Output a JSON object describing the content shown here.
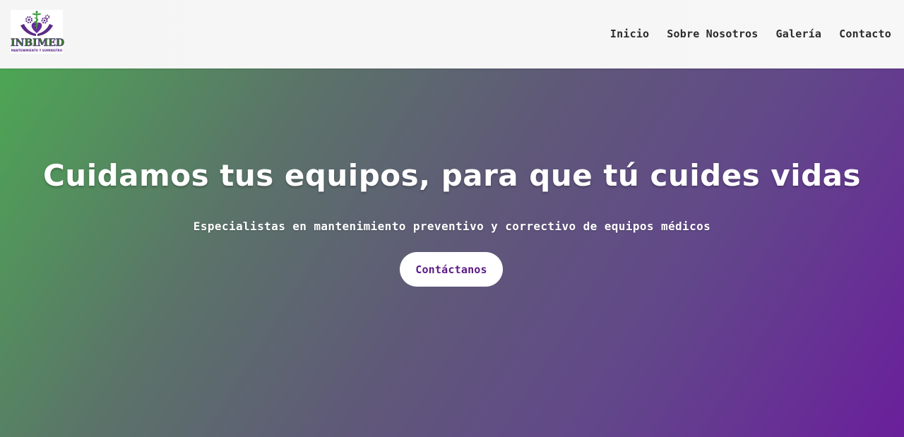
{
  "header": {
    "logo": {
      "word": "INBIMED",
      "subtitle": "MANTENIMIENTO Y SUMINISTRO"
    },
    "nav": [
      {
        "label": "Inicio"
      },
      {
        "label": "Sobre Nosotros"
      },
      {
        "label": "Galería"
      },
      {
        "label": "Contacto"
      }
    ]
  },
  "hero": {
    "title": "Cuidamos tus equipos, para que tú cuides vidas",
    "subtitle": "Especialistas en mantenimiento preventivo y correctivo de equipos médicos",
    "cta_label": "Contáctanos"
  },
  "colors": {
    "brand_purple": "#5b1a86",
    "brand_green": "#4da654",
    "nav_text": "#2b2b2b"
  }
}
